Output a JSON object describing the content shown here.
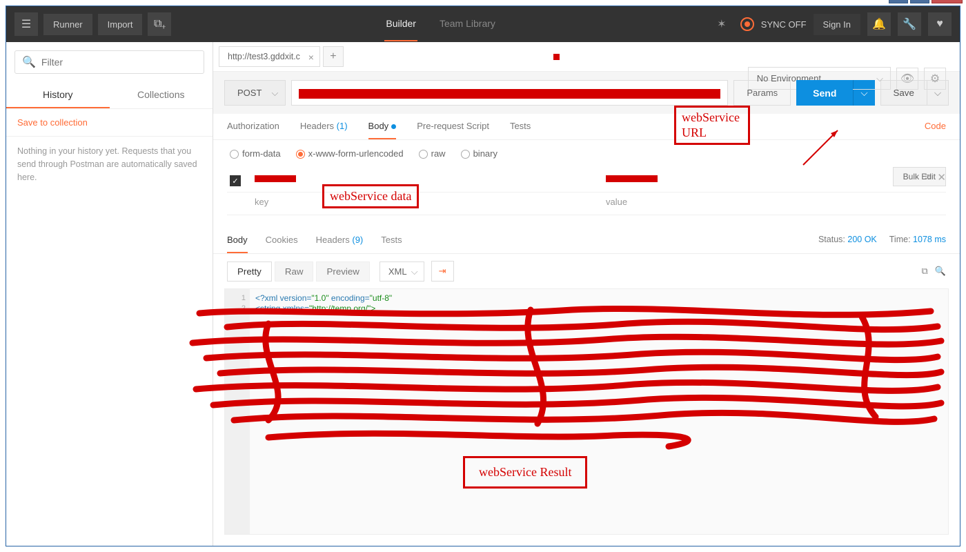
{
  "window": {
    "minimize": "—",
    "maximize": "□",
    "close": "✕"
  },
  "topbar": {
    "runner": "Runner",
    "import": "Import",
    "builder": "Builder",
    "team_library": "Team Library",
    "sync": "SYNC OFF",
    "signin": "Sign In"
  },
  "sidebar": {
    "filter_placeholder": "Filter",
    "tabs": {
      "history": "History",
      "collections": "Collections"
    },
    "save_link": "Save to collection",
    "history_empty": "Nothing in your history yet. Requests that you send through Postman are automatically saved here."
  },
  "env": {
    "label": "No Environment"
  },
  "request_tab": {
    "title": "http://test3.gddxit.c"
  },
  "request": {
    "method": "POST",
    "params": "Params",
    "send": "Send",
    "save": "Save"
  },
  "req_subtabs": {
    "authorization": "Authorization",
    "headers": "Headers",
    "headers_count": "(1)",
    "body": "Body",
    "prereq": "Pre-request Script",
    "tests": "Tests",
    "code": "Code"
  },
  "body_types": {
    "formdata": "form-data",
    "urlenc": "x-www-form-urlencoded",
    "raw": "raw",
    "binary": "binary"
  },
  "kv": {
    "key_ph": "key",
    "value_ph": "value",
    "bulk": "Bulk Edit"
  },
  "resp_tabs": {
    "body": "Body",
    "cookies": "Cookies",
    "headers": "Headers",
    "headers_count": "(9)",
    "tests": "Tests"
  },
  "resp_meta": {
    "status_label": "Status:",
    "status_val": "200 OK",
    "time_label": "Time:",
    "time_val": "1078 ms"
  },
  "resp_ctrl": {
    "pretty": "Pretty",
    "raw": "Raw",
    "preview": "Preview",
    "fmt": "XML"
  },
  "resp_body": {
    "line1_a": "<?xml version=",
    "line1_b": "\"1.0\"",
    "line1_c": " encoding=",
    "line1_d": "\"utf-8\"",
    "line2_a": "<string xmlns=",
    "line2_b": "\"http://temp",
    "line2_c": ".org/\">"
  },
  "annot": {
    "url": "webService\nURL",
    "data": "webService data",
    "result": "webService  Result"
  }
}
